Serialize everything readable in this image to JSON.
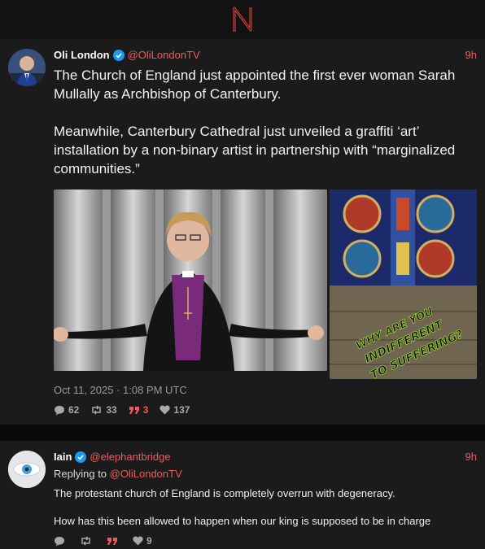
{
  "app": {
    "logo_icon": "n-logo-icon",
    "accent": "#f25a5a"
  },
  "posts": [
    {
      "author": "Oli London",
      "handle": "@OliLondonTV",
      "time": "9h",
      "verified": true,
      "text": "The Church of England just appointed the first ever woman Sarah Mullally as Archbishop of Canterbury.\n\nMeanwhile, Canterbury Cathedral just unveiled a graffiti ‘art’ installation by a non-binary artist in partnership with “marginalized communities.”",
      "media_overlay_text": [
        "WHY ARE YOU",
        "INDIFFERENT",
        "TO SUFFERING?"
      ],
      "date": "Oct 11, 2025 · 1:08 PM UTC",
      "stats": {
        "replies": "62",
        "retweets": "33",
        "quotes": "3",
        "likes": "137"
      }
    },
    {
      "author": "Iain",
      "handle": "@elephantbridge",
      "time": "9h",
      "verified": true,
      "replying_label": "Replying to",
      "replying_handle": "@OliLondonTV",
      "text": "The protestant church of England is completely overrun with degeneracy.\n\nHow has this been allowed to happen when our king is supposed to be in charge",
      "stats": {
        "replies": "",
        "retweets": "",
        "quotes": "",
        "likes": "9"
      }
    }
  ]
}
